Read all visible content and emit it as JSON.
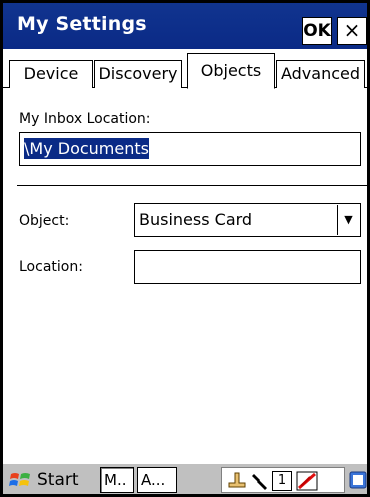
{
  "window": {
    "title": "My Settings",
    "ok_label": "OK",
    "close_label": "×"
  },
  "tabs": [
    {
      "label": "Device"
    },
    {
      "label": "Discovery"
    },
    {
      "label": "Objects"
    },
    {
      "label": "Advanced"
    }
  ],
  "active_tab": "Objects",
  "objects_panel": {
    "inbox_label": "My Inbox Location:",
    "inbox_value": "\\My Documents",
    "object_label": "Object:",
    "object_value": "Business Card",
    "location_label": "Location:",
    "location_value": ""
  },
  "taskbar": {
    "start_label": "Start",
    "task_buttons": [
      "M..",
      "A..."
    ],
    "tray_number": "1"
  },
  "colors": {
    "titlebar": "#0a2a86",
    "selection": "#0a2a86",
    "taskbar": "#c0c0c0"
  }
}
